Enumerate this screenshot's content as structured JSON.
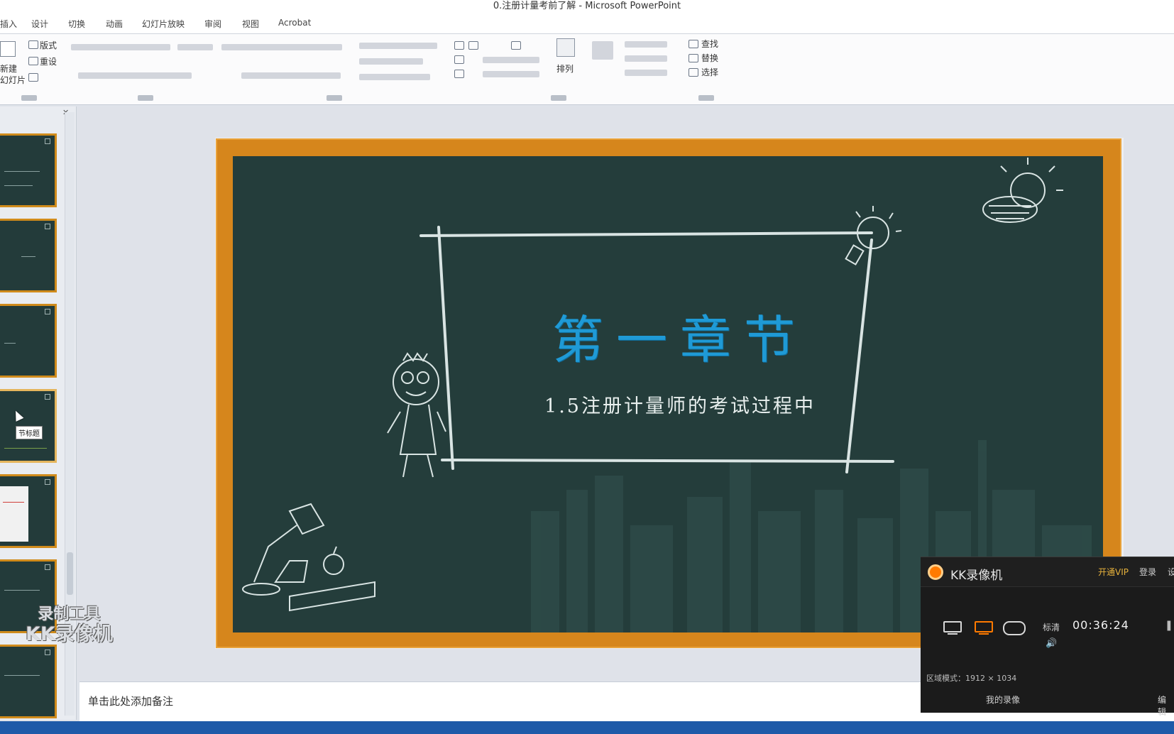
{
  "window": {
    "title": "0.注册计量考前了解 - Microsoft PowerPoint"
  },
  "ribbon": {
    "tabs": [
      "插入",
      "设计",
      "切换",
      "动画",
      "幻灯片放映",
      "审阅",
      "视图",
      "Acrobat"
    ],
    "labels": {
      "layout": "版式",
      "reset": "重设",
      "new_slide_1": "新建",
      "new_slide_2": "幻灯片",
      "arrange": "排列",
      "find": "查找",
      "replace": "替换",
      "select": "选择"
    }
  },
  "thumbnail_pane": {
    "tooltip": "节标题"
  },
  "slide": {
    "chapter_title": "第一章节",
    "subtitle": "1.5注册计量师的考试过程中"
  },
  "notes": {
    "placeholder": "单击此处添加备注"
  },
  "watermark": {
    "line1": "录制工具",
    "line2": "KK录像机"
  },
  "kk_recorder": {
    "title": "KK录像机",
    "header_links": [
      "开通VIP",
      "登录",
      "设"
    ],
    "quality": "标清",
    "time": "00:36:24",
    "area_mode": "区域模式：1912 × 1034",
    "my_recordings": "我的录像",
    "edit": "编辑",
    "colors": {
      "accent": "#ff7a00",
      "vip": "#e7b23c"
    }
  },
  "colors": {
    "board": "#243d3b",
    "frame": "#d6861c",
    "title_blue": "#1f9ad6",
    "statusbar": "#1e5aa8"
  }
}
